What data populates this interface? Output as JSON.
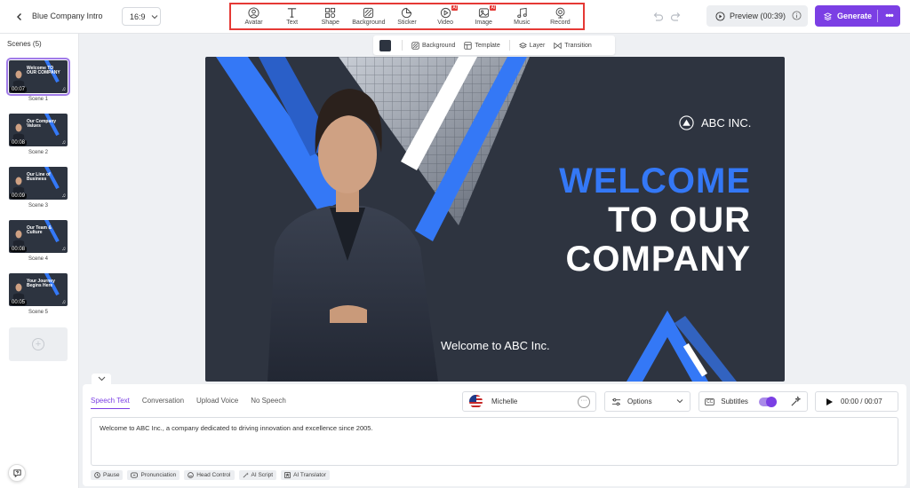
{
  "header": {
    "project_title": "Blue Company Intro",
    "aspect_ratio": "16:9",
    "tools": [
      {
        "label": "Avatar",
        "icon": "avatar-icon",
        "ai": false
      },
      {
        "label": "Text",
        "icon": "text-icon",
        "ai": false
      },
      {
        "label": "Shape",
        "icon": "shape-icon",
        "ai": false
      },
      {
        "label": "Background",
        "icon": "background-icon",
        "ai": false
      },
      {
        "label": "Sticker",
        "icon": "sticker-icon",
        "ai": false
      },
      {
        "label": "Video",
        "icon": "video-icon",
        "ai": true,
        "badge": "AI"
      },
      {
        "label": "Image",
        "icon": "image-icon",
        "ai": true,
        "badge": "AI"
      },
      {
        "label": "Music",
        "icon": "music-icon",
        "ai": false
      },
      {
        "label": "Record",
        "icon": "record-icon",
        "ai": false
      }
    ],
    "preview_label": "Preview (00:39)",
    "generate_label": "Generate"
  },
  "sidebar": {
    "title": "Scenes (5)",
    "scenes": [
      {
        "label": "Scene 1",
        "duration": "00:07",
        "thumb_text": "Welcome TO OUR COMPANY",
        "selected": true
      },
      {
        "label": "Scene 2",
        "duration": "00:08",
        "thumb_text": "Our Company Values",
        "selected": false
      },
      {
        "label": "Scene 3",
        "duration": "00:09",
        "thumb_text": "Our Line of Business",
        "selected": false
      },
      {
        "label": "Scene 4",
        "duration": "00:08",
        "thumb_text": "Our Team & Culture",
        "selected": false
      },
      {
        "label": "Scene 5",
        "duration": "00:05",
        "thumb_text": "Your Journey Begins Here",
        "selected": false
      }
    ]
  },
  "canvas_toolbar": {
    "swatch_color": "#2d3440",
    "background_label": "Background",
    "template_label": "Template",
    "layer_label": "Layer",
    "transition_label": "Transition"
  },
  "canvas": {
    "brand": "ABC INC.",
    "headline_1": "WELCOME",
    "headline_2": "TO OUR",
    "headline_3": "COMPANY",
    "caption": "Welcome to ABC Inc.",
    "accent_color": "#3478f6",
    "bg_color": "#2e3440"
  },
  "bottom_panel": {
    "tabs": [
      "Speech Text",
      "Conversation",
      "Upload Voice",
      "No Speech"
    ],
    "active_tab": "Speech Text",
    "voice_name": "Michelle",
    "options_label": "Options",
    "subtitles_label": "Subtitles",
    "subtitles_on": true,
    "time": "00:00 / 00:07",
    "script": "Welcome to ABC Inc., a company dedicated to driving innovation and excellence since 2005.",
    "chips": [
      {
        "label": "Pause",
        "icon": "clock-icon"
      },
      {
        "label": "Pronunciation",
        "icon": "pronunciation-icon"
      },
      {
        "label": "Head Control",
        "icon": "head-icon"
      },
      {
        "label": "AI Script",
        "icon": "ai-script-icon"
      },
      {
        "label": "AI Translator",
        "icon": "translate-icon"
      }
    ]
  }
}
